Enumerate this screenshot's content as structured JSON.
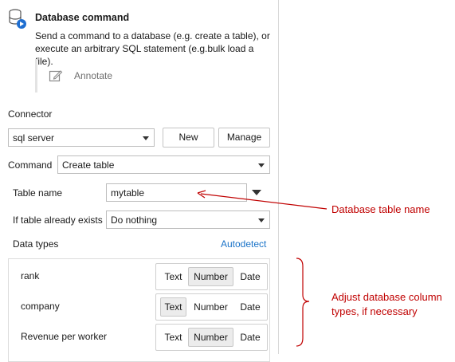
{
  "header": {
    "title": "Database command",
    "description": "Send a command to a database (e.g. create a table), or execute an arbitrary SQL statement (e.g.bulk load a file).",
    "annotate_label": "Annotate"
  },
  "connector": {
    "label": "Connector",
    "value": "sql server",
    "new_button": "New",
    "manage_button": "Manage"
  },
  "command": {
    "label": "Command",
    "value": "Create table"
  },
  "table_name": {
    "label": "Table name",
    "value": "mytable"
  },
  "if_exists": {
    "label": "If table already exists",
    "value": "Do nothing"
  },
  "data_types": {
    "label": "Data types",
    "autodetect_link": "Autodetect",
    "columns": [
      {
        "name": "rank",
        "options": [
          "Text",
          "Number",
          "Date"
        ],
        "selected": "Number"
      },
      {
        "name": "company",
        "options": [
          "Text",
          "Number",
          "Date"
        ],
        "selected": "Text"
      },
      {
        "name": "Revenue per worker",
        "options": [
          "Text",
          "Number",
          "Date"
        ],
        "selected": "Number"
      }
    ]
  },
  "annotations": {
    "table_name_callout": "Database table name",
    "types_callout": "Adjust database column types, if necessary",
    "callout_color": "#c00000"
  },
  "colors": {
    "link": "#1a73c8",
    "selected_option_bg": "#ececec",
    "icon_blue": "#1f6fd1"
  }
}
